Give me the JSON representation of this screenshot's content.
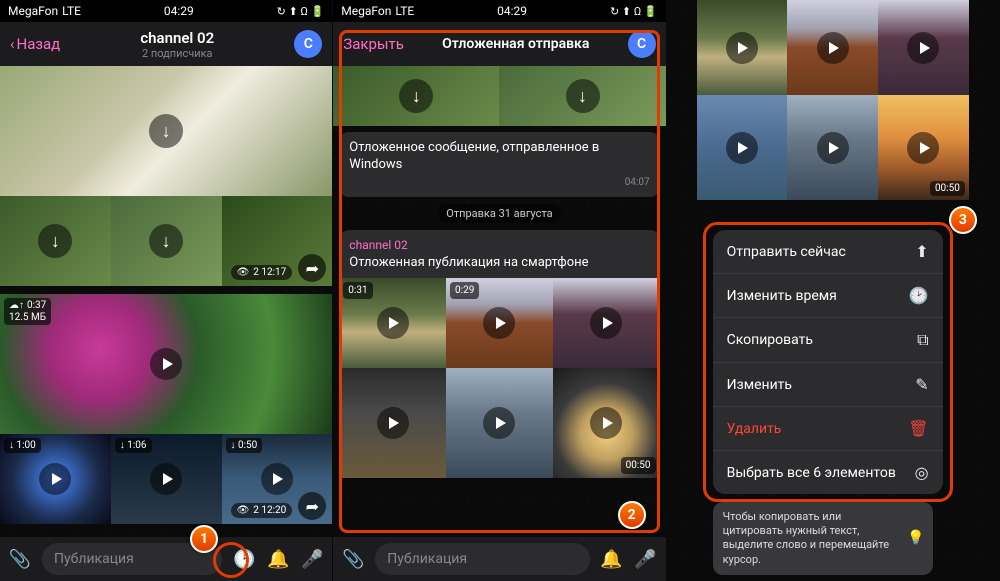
{
  "status": {
    "carrier": "MegaFon",
    "network": "LTE",
    "time": "04:29",
    "icons": "↻ ⬆ Ω 🔋"
  },
  "p1": {
    "back": "Назад",
    "title": "channel 02",
    "subtitle": "2 подписчика",
    "avatar": "C",
    "views1": "2 12:17",
    "upload": {
      "dur": "0:37",
      "size": "12.5 МБ"
    },
    "thumbs": [
      {
        "dur": "1:00"
      },
      {
        "dur": "1:06"
      },
      {
        "dur": "0:50"
      }
    ],
    "views2": "2 12:20",
    "composer": "Публикация"
  },
  "p2": {
    "close": "Закрыть",
    "title": "Отложенная отправка",
    "avatar": "C",
    "msg1": {
      "text": "Отложенное сообщение, отправленное в Windows",
      "time": "04:07"
    },
    "date": "Отправка 31 августа",
    "msg2": {
      "channel": "channel 02",
      "text": "Отложенная публикация на смартфоне"
    },
    "thumbs": {
      "d1": "0:31",
      "d2": "0:29",
      "d3": "00:50"
    },
    "composer": "Публикация"
  },
  "p3": {
    "d1": "00:50",
    "menu": [
      {
        "label": "Отправить сейчас",
        "icon": "send",
        "danger": false
      },
      {
        "label": "Изменить время",
        "icon": "clock",
        "danger": false
      },
      {
        "label": "Скопировать",
        "icon": "copy",
        "danger": false
      },
      {
        "label": "Изменить",
        "icon": "edit",
        "danger": false
      },
      {
        "label": "Удалить",
        "icon": "trash",
        "danger": true
      },
      {
        "label": "Выбрать все 6 элементов",
        "icon": "select",
        "danger": false
      }
    ],
    "hint": "Чтобы копировать или цитировать нужный текст, выделите слово и перемещайте курсор."
  },
  "steps": {
    "s1": "1",
    "s2": "2",
    "s3": "3"
  }
}
